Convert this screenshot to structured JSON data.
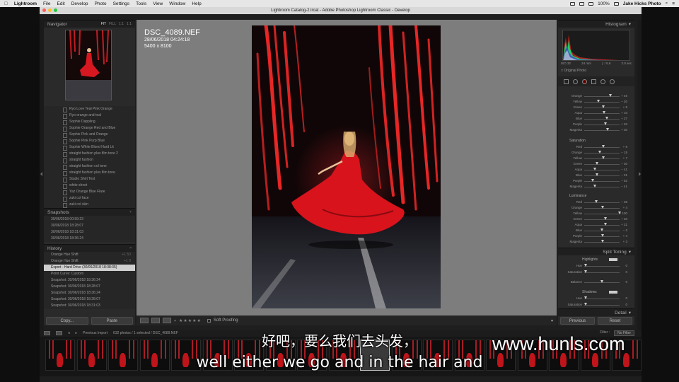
{
  "menubar": {
    "app": "Lightroom",
    "items": [
      "File",
      "Edit",
      "Develop",
      "Photo",
      "Settings",
      "Tools",
      "View",
      "Window",
      "Help"
    ],
    "battery": "100%",
    "user": "Jake Hicks Photo"
  },
  "window_title": "Lightroom Catalog-2.lrcat - Adobe Photoshop Lightroom Classic - Develop",
  "navigator": {
    "title": "Navigator",
    "zoom_opts": [
      "FIT",
      "FILL",
      "1:1",
      "1:1"
    ]
  },
  "presets": [
    "Ryo Love Teal Pink Orange",
    "Ryo orange and teal",
    "Sophie Dappling",
    "Sophie Orange Red and Blue",
    "Sophie Pink and Orange",
    "Sophie Pink Purp Blue",
    "Sophie White Blond Hard Lit",
    "straight fashion plus film tone 2",
    "straight fashion",
    "straight fashion col tone",
    "straight fashion plus film tone",
    "Studio Shirt Test",
    "white sheet",
    "Yaz Orange Blue Flare",
    "zuki col face",
    "zuki col skin"
  ],
  "snapshots": {
    "title": "Snapshots",
    "items": [
      "30/06/2018 00:59:23",
      "30/06/2018 18:28:07",
      "30/06/2018 18:31:03",
      "30/06/2018 18:36:24"
    ]
  },
  "history": {
    "title": "History",
    "items": [
      {
        "label": "Orange Hue Shift",
        "v": "+1  50"
      },
      {
        "label": "Orange Hue Shift",
        "v": "+1  0"
      },
      {
        "label": "Export - Hard Drive (30/06/2018 18:38:35)",
        "v": "",
        "sel": true
      },
      {
        "label": "Point Curve: Custom",
        "v": ""
      },
      {
        "label": "Snapshot: 30/06/2018 18:36:24",
        "v": ""
      },
      {
        "label": "Snapshot: 30/06/2018 18:28:07",
        "v": ""
      },
      {
        "label": "Snapshot: 30/06/2018 18:36:24",
        "v": ""
      },
      {
        "label": "Snapshot: 30/06/2018 18:28:07",
        "v": ""
      },
      {
        "label": "Snapshot: 30/06/2018 18:31:03",
        "v": ""
      }
    ]
  },
  "copy_label": "Copy...",
  "paste_label": "Paste",
  "photo_info": {
    "filename": "DSC_4089.NEF",
    "datetime": "28/06/2018 04:24:18",
    "dims": "5400 x 8100"
  },
  "toolbar": {
    "stars": "★★★★★",
    "soft_proofing": "Soft Proofing"
  },
  "histogram": {
    "title": "Histogram",
    "iso": "ISO 32",
    "focal": "24 mm",
    "aperture": "ƒ / 5.6",
    "shutter": "2.0 sec",
    "original": "Original Photo"
  },
  "hsl_hue": [
    {
      "l": "Orange",
      "v": "+ 46",
      "p": 0.73
    },
    {
      "l": "Yellow",
      "v": "− 20",
      "p": 0.4
    },
    {
      "l": "Green",
      "v": "+ 5",
      "p": 0.53
    },
    {
      "l": "Aqua",
      "v": "+ 10",
      "p": 0.55
    },
    {
      "l": "Blue",
      "v": "+ 27",
      "p": 0.63
    },
    {
      "l": "Purple",
      "v": "+ 20",
      "p": 0.6
    },
    {
      "l": "Magenta",
      "v": "+ 30",
      "p": 0.65
    }
  ],
  "saturation": {
    "title": "Saturation",
    "rows": [
      {
        "l": "Red",
        "v": "+ 6",
        "p": 0.53
      },
      {
        "l": "Orange",
        "v": "− 15",
        "p": 0.43
      },
      {
        "l": "Yellow",
        "v": "+ 7",
        "p": 0.54
      },
      {
        "l": "Green",
        "v": "− 30",
        "p": 0.35
      },
      {
        "l": "Aqua",
        "v": "− 41",
        "p": 0.3
      },
      {
        "l": "Blue",
        "v": "− 31",
        "p": 0.35
      },
      {
        "l": "Purple",
        "v": "− 52",
        "p": 0.24
      },
      {
        "l": "Magenta",
        "v": "− 41",
        "p": 0.3
      }
    ]
  },
  "luminance": {
    "title": "Luminance",
    "rows": [
      {
        "l": "Red",
        "v": "− 35",
        "p": 0.33
      },
      {
        "l": "Orange",
        "v": "+ 4",
        "p": 0.52
      },
      {
        "l": "Yellow",
        "v": "+ 100",
        "p": 1.0
      },
      {
        "l": "Green",
        "v": "+ 20",
        "p": 0.6
      },
      {
        "l": "Aqua",
        "v": "+ 21",
        "p": 0.6
      },
      {
        "l": "Blue",
        "v": "− 2",
        "p": 0.49
      },
      {
        "l": "Purple",
        "v": "+ 4",
        "p": 0.52
      },
      {
        "l": "Magenta",
        "v": "+ 3",
        "p": 0.51
      }
    ]
  },
  "split_toning": {
    "title": "Split Toning",
    "highlights": "Highlights",
    "hue": "Hue",
    "saturation": "Saturation",
    "balance": "Balance",
    "shadows": "Shadows",
    "zero": "0"
  },
  "detail_title": "Detail",
  "previous_label": "Previous",
  "reset_label": "Reset",
  "filmstrip": {
    "nav": "Previous Import",
    "count": "632 photos / 1 selected / DSC_4089.NEF",
    "filter_label": "Filter :",
    "filter_value": "No Filter"
  },
  "watermark": "www.hunls.com",
  "subtitle_cn": "好吧，要么我们去头发，",
  "subtitle_en": "well either we go and in the hair and"
}
